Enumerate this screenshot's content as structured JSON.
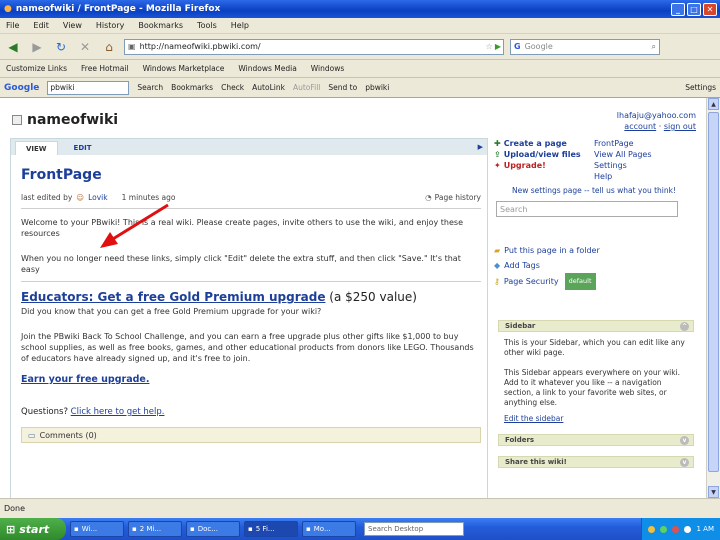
{
  "window": {
    "title": "nameofwiki / FrontPage - Mozilla Firefox"
  },
  "menu": [
    "File",
    "Edit",
    "View",
    "History",
    "Bookmarks",
    "Tools",
    "Help"
  ],
  "nav": {
    "url": "http://nameofwiki.pbwiki.com/",
    "search_placeholder": "Google"
  },
  "bookmarks": [
    "Customize Links",
    "Free Hotmail",
    "Windows Marketplace",
    "Windows Media",
    "Windows"
  ],
  "googlebar": {
    "logo": "Google",
    "query": "pbwiki",
    "items": [
      "Search",
      "Bookmarks",
      "Check",
      "AutoLink",
      "AutoFill",
      "Send to",
      "pbwiki"
    ],
    "settings": "Settings"
  },
  "wiki": {
    "name": "nameofwiki",
    "account": {
      "email": "lhafaju@yahoo.com",
      "account_link": "account",
      "signout_link": "sign out"
    },
    "tabs": {
      "view": "VIEW",
      "edit": "EDIT"
    },
    "page_title": "FrontPage",
    "meta": {
      "prefix": "last edited by",
      "user": "Lovik",
      "time": "1 minutes ago",
      "history": "Page history"
    },
    "intro": "Welcome to your PBwiki! This is a real wiki. Please create pages, invite others to use the wiki, and enjoy these resources",
    "remove_note": "When you no longer need these links, simply click \"Edit\" delete the extra stuff, and then click \"Save.\" It's that easy",
    "edu_link": "Educators: Get a free Gold Premium upgrade",
    "edu_value": "(a $250 value)",
    "edu_q": "Did you know that you can get a free Gold Premium upgrade for your wiki?",
    "edu_body": "Join the PBwiki Back To School Challenge, and you can earn a free upgrade plus other gifts like $1,000 to buy school supplies, as well as free books, games, and other educational products from donors like LEGO. Thousands of educators have already signed up, and it's free to join.",
    "earn_link": "Earn your free upgrade.",
    "questions_prefix": "Questions?",
    "questions_link": "Click here to get help.",
    "comments": "Comments (0)"
  },
  "side": {
    "actions_left": [
      "Create a page",
      "Upload/view files",
      "Upgrade!"
    ],
    "actions_right": [
      "FrontPage",
      "View All Pages",
      "Settings",
      "Help"
    ],
    "feedback": "New settings page -- tell us what you think!",
    "search_placeholder": "Search",
    "folder": "Put this page in a folder",
    "tags": "Add Tags",
    "security": "Page Security",
    "security_badge": "default",
    "sidebar_title": "Sidebar",
    "sidebar_text1": "This is your Sidebar, which you can edit like any other wiki page.",
    "sidebar_text2": "This Sidebar appears everywhere on your wiki. Add to it whatever you like -- a navigation section, a link to your favorite web sites, or anything else.",
    "sidebar_edit": "Edit the sidebar",
    "folders_title": "Folders",
    "share_title": "Share this wiki!"
  },
  "status": "Done",
  "taskbar": {
    "start": "start",
    "buttons": [
      "Wi...",
      "2 Mi...",
      "Doc...",
      "5 Fi...",
      "Mo..."
    ],
    "search": "Search Desktop",
    "clock": "1 AM"
  },
  "colors": {
    "link": "#1d3f9a",
    "arrow": "#e01010",
    "tab_bar": "#dfe9ee"
  }
}
